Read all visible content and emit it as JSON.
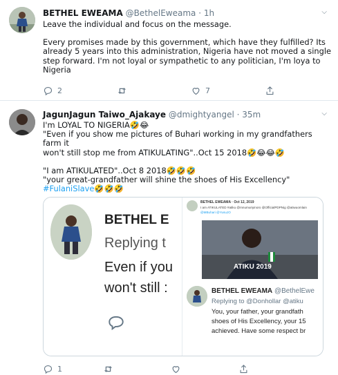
{
  "tweets": [
    {
      "author": "BETHEL EWEAMA",
      "handle": "@BethelEweama",
      "time": "· 1h",
      "lines": [
        "Leave the individual and focus on the message.",
        "",
        "Every promises made by this government, which have they fulfilled? Its",
        "already 5 years into this administration, Nigeria have not moved a single",
        "step forward. I'm not loyal or sympathetic to any politician, I'm loya to",
        "Nigeria"
      ],
      "replies": "2",
      "retweets": "",
      "likes": "7"
    },
    {
      "author": "JagunJagun Taiwo_Ajakaye",
      "handle": "@dmightyangel",
      "time": "· 35m",
      "lines": [
        "I'm LOYAL TO NIGERIA🤣😂",
        "\"Even if you show me  pictures of Buhari working in my grandfathers farm it",
        "won't still stop me from ATIKULATING\"..Oct 15 2018🤣😂😂🤣",
        "",
        "\"I am ATIKULATED\"..Oct 8 2018🤣🤣🤣",
        "\"your great-grandfather will shine the shoes of His Excellency\""
      ],
      "hashtag": "#FulaniSlave",
      "hashtag_suffix": "🤣🤣🤣",
      "replies": "1",
      "retweets": "",
      "likes": ""
    }
  ],
  "embedded_image": {
    "zoom_name": "BETHEL E",
    "zoom_reply": "Replying t",
    "zoom_line1": "Even if you",
    "zoom_line2": "won't still :",
    "small_header": "BETHEL EWEAMA · Oct 12, 2019",
    "small_line1": "I am ATIKULATED #atiku @mnumuriyinoro @OfficialPDPNig @atiwuomlain",
    "small_line2": "@MBuhari @YusuJO",
    "shirt_text": "ATIKU 2019",
    "quote_name": "BETHEL EWEAMA",
    "quote_handle": "@BethelEwe",
    "quote_reply": "Replying to @Donhollar @atiku",
    "quote_line1": "You, your father, your grandfath",
    "quote_line2": "shoes of His Excellency, your 15",
    "quote_line3": "achieved. Have some respect br"
  },
  "colors": {
    "accent": "#1da1f2",
    "muted": "#657786",
    "text": "#14171a",
    "border": "#e1e8ed"
  }
}
